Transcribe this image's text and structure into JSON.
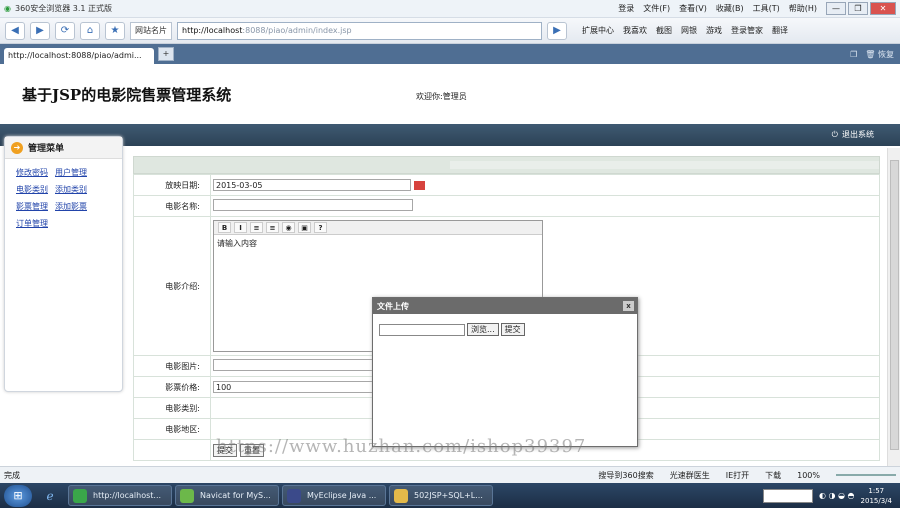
{
  "browser": {
    "title": "360安全浏览器 3.1 正式版",
    "menus": [
      "登录",
      "文件(F)",
      "查看(V)",
      "收藏(B)",
      "工具(T)",
      "帮助(H)"
    ],
    "window_buttons": [
      "—",
      "❐",
      "✕"
    ],
    "nav": {
      "back": "◀",
      "forward": "▶",
      "refresh": "⟳",
      "home": "⌂",
      "star": "★",
      "fav_label": "网站名片",
      "address_value": "http://localhost:8088/piao/admin/index.jsp",
      "address_host": "http://localhost",
      "address_rest": ":8088/piao/admin/index.jsp",
      "go": "▶",
      "tools": [
        "扩展中心",
        "我喜欢",
        "截图",
        "网银",
        "游戏",
        "登录管家",
        "翻译"
      ]
    },
    "tab": {
      "label": "http://localhost:8088/piao/admi...",
      "new_tab": "+",
      "right_tools": [
        "❐",
        "🗑 恢复"
      ]
    }
  },
  "page": {
    "site_title": "基于JSP的电影院售票管理系统",
    "welcome": "欢迎你:管理员",
    "logout": "退出系统"
  },
  "sidebar": {
    "title": "管理菜单",
    "links": [
      [
        "修改密码",
        "用户管理"
      ],
      [
        "电影类别",
        "添加类别"
      ],
      [
        "影票管理",
        "添加影票"
      ],
      [
        "订单管理"
      ]
    ]
  },
  "form": {
    "rows": [
      {
        "label": "放映日期:",
        "value": "2015-03-05"
      },
      {
        "label": "电影名称:",
        "value": ""
      },
      {
        "label": "电影介绍:",
        "value": "请输入内容"
      },
      {
        "label": "电影图片:",
        "value": ""
      },
      {
        "label": "影票价格:",
        "value": "100"
      },
      {
        "label": "电影类别:",
        "value": ""
      },
      {
        "label": "电影地区:",
        "value": ""
      }
    ],
    "editor_tools": [
      "B",
      "I",
      "≡",
      "≡",
      "◉",
      "▣",
      "?"
    ],
    "submit": "提交",
    "reset": "重置"
  },
  "dialog": {
    "title": "文件上传",
    "close": "x",
    "browse": "浏览...",
    "submit": "提交"
  },
  "watermark": "https://www.huzhan.com/ishop39397",
  "statusbar": {
    "left": "完成",
    "items": [
      "搜导到360搜索",
      "光速群医生",
      "IE打开",
      "下载",
      "100%"
    ]
  },
  "taskbar": {
    "start": "⊞",
    "buttons": [
      "http://localhost...",
      "Navicat for MyS...",
      "MyEclipse Java ...",
      "502JSP+SQL+L..."
    ],
    "clock_time": "1:57",
    "clock_date": "2015/3/4"
  },
  "colors": {
    "header_strip": "#2c4256",
    "tab_bar": "#4f6e93",
    "taskbar": "#1c2e45",
    "dialog_title": "#6b6b6b"
  }
}
